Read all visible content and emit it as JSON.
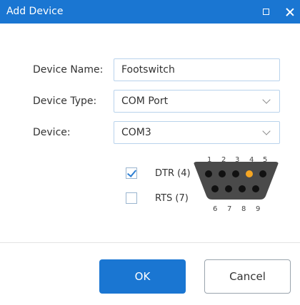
{
  "window": {
    "title": "Add Device",
    "accent_color": "#1a76d2",
    "controls": {
      "maximize_icon": "maximize-icon",
      "close_icon": "close-icon"
    }
  },
  "form": {
    "device_name": {
      "label": "Device Name:",
      "value": "Footswitch"
    },
    "device_type": {
      "label": "Device Type:",
      "selected": "COM Port"
    },
    "device": {
      "label": "Device:",
      "selected": "COM3"
    }
  },
  "signals": [
    {
      "label": "DTR (4)",
      "checked": true
    },
    {
      "label": "RTS (7)",
      "checked": false
    }
  ],
  "connector": {
    "top_pins": [
      "1",
      "2",
      "3",
      "4",
      "5"
    ],
    "bottom_pins": [
      "6",
      "7",
      "8",
      "9"
    ],
    "highlighted_pin": "4",
    "highlight_color": "#f5a623"
  },
  "buttons": {
    "ok": "OK",
    "cancel": "Cancel"
  }
}
